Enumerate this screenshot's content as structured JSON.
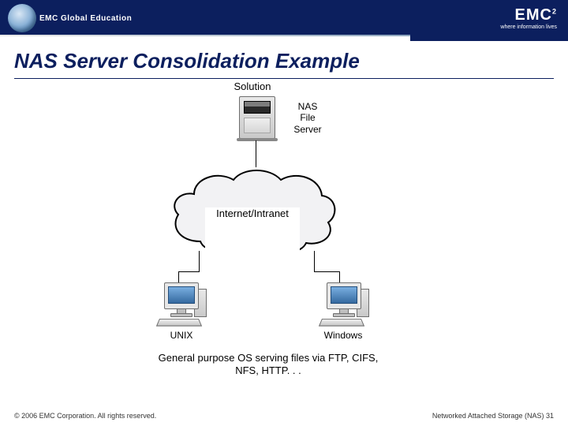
{
  "header": {
    "brand_left": "EMC Global Education",
    "brand_right": "EMC",
    "brand_right_sup": "2",
    "tagline": "where information lives"
  },
  "title": "NAS Server Consolidation Example",
  "diagram": {
    "solution_label": "Solution",
    "nas_label": "NAS\nFile\nServer",
    "cloud_label": "Internet/Intranet",
    "client_left_label": "UNIX",
    "client_right_label": "Windows",
    "caption": "General purpose OS serving files via FTP, CIFS, NFS, HTTP. . ."
  },
  "footer": {
    "copyright": "© 2006 EMC Corporation. All rights reserved.",
    "page_ref": "Networked Attached Storage (NAS) 31"
  }
}
